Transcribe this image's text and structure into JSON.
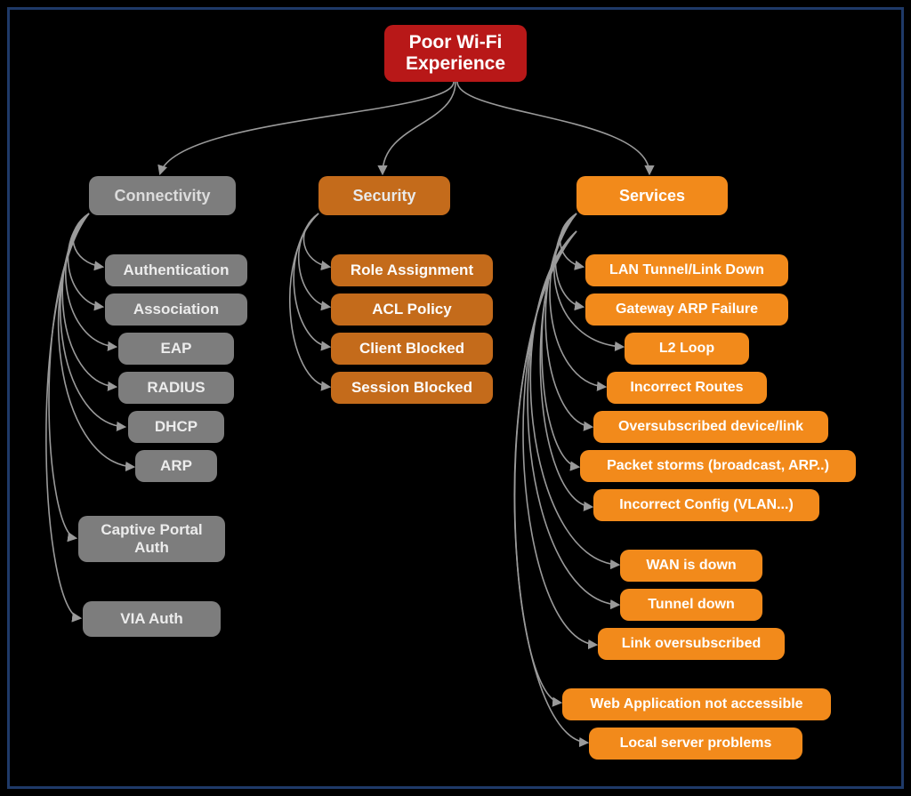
{
  "root": {
    "title": "Poor Wi-Fi Experience"
  },
  "categories": {
    "connectivity": {
      "label": "Connectivity"
    },
    "security": {
      "label": "Security"
    },
    "services": {
      "label": "Services"
    }
  },
  "connectivity_items": {
    "authentication": "Authentication",
    "association": "Association",
    "eap": "EAP",
    "radius": "RADIUS",
    "dhcp": "DHCP",
    "arp": "ARP",
    "captive_portal": "Captive Portal Auth",
    "via_auth": "VIA Auth"
  },
  "security_items": {
    "role_assignment": "Role Assignment",
    "acl_policy": "ACL Policy",
    "client_blocked": "Client Blocked",
    "session_blocked": "Session Blocked"
  },
  "services_items": {
    "lan_tunnel": "LAN Tunnel/Link Down",
    "gateway_arp": "Gateway ARP Failure",
    "l2_loop": "L2 Loop",
    "incorrect_routes": "Incorrect Routes",
    "oversub_device": "Oversubscribed device/link",
    "packet_storms": "Packet storms (broadcast, ARP..)",
    "incorrect_config": "Incorrect Config (VLAN...)",
    "wan_down": "WAN is down",
    "tunnel_down": "Tunnel down",
    "link_oversub": "Link oversubscribed",
    "webapp": "Web Application not accessible",
    "local_server": "Local server problems"
  }
}
